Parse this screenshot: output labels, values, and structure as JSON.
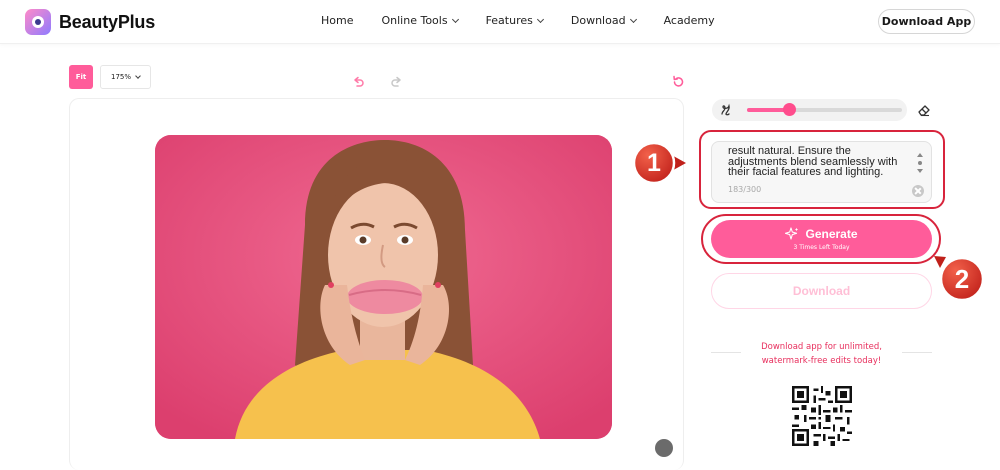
{
  "app": {
    "name": "BeautyPlus",
    "brand_color": "#ff5c9a",
    "highlight_color": "#d8243c"
  },
  "nav": {
    "items": [
      {
        "label": "Home",
        "has_dropdown": false
      },
      {
        "label": "Online Tools",
        "has_dropdown": true
      },
      {
        "label": "Features",
        "has_dropdown": true
      },
      {
        "label": "Download",
        "has_dropdown": true
      },
      {
        "label": "Academy",
        "has_dropdown": false
      }
    ],
    "download_app_label": "Download App"
  },
  "toolbar": {
    "fit_label": "Fit",
    "zoom_value": "175%",
    "icons": [
      "undo-icon",
      "redo-icon",
      "reset-icon"
    ]
  },
  "canvas": {
    "image_alt_name": "edited-portrait-photo"
  },
  "brush": {
    "size_fraction": 0.27,
    "icons": [
      "brush-icon",
      "eraser-icon"
    ]
  },
  "prompt": {
    "text": "result natural. Ensure the\nadjustments blend seamlessly with\ntheir facial features and lighting.",
    "count": "183/300"
  },
  "generate": {
    "label": "Generate",
    "sub_label": "3 Times Left Today"
  },
  "download": {
    "label": "Download"
  },
  "promo": {
    "line1": "Download app for unlimited,",
    "line2": "watermark-free edits today!"
  },
  "annotations": {
    "step1": "1",
    "step2": "2"
  }
}
